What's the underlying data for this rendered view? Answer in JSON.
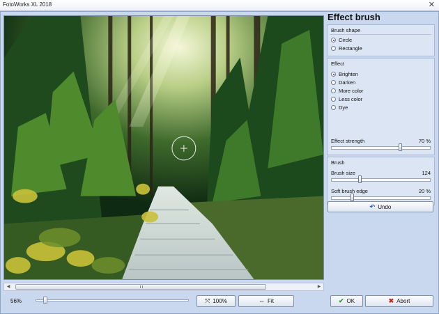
{
  "window": {
    "title": "FotoWorks XL 2018",
    "close_glyph": "✕"
  },
  "panel": {
    "title": "Effect brush",
    "brush_shape": {
      "title": "Brush shape",
      "options": [
        {
          "label": "Circle",
          "selected": true
        },
        {
          "label": "Rectangle",
          "selected": false
        }
      ]
    },
    "effect": {
      "title": "Effect",
      "options": [
        {
          "label": "Brighten",
          "selected": true
        },
        {
          "label": "Darken",
          "selected": false
        },
        {
          "label": "More color",
          "selected": false
        },
        {
          "label": "Less color",
          "selected": false
        },
        {
          "label": "Dye",
          "selected": false
        }
      ]
    },
    "effect_strength": {
      "label": "Effect strength",
      "value_text": "70 %",
      "fraction": 0.7
    },
    "brush": {
      "title": "Brush",
      "size": {
        "label": "Brush size",
        "value_text": "124",
        "fraction": 0.28
      },
      "soft_edge": {
        "label": "Soft brush edge",
        "value_text": "20 %",
        "fraction": 0.2
      }
    },
    "undo_label": "Undo"
  },
  "bottom": {
    "zoom_text": "56%",
    "zoom_fraction": 0.05,
    "btn_100": "100%",
    "btn_fit": "Fit",
    "btn_ok": "OK",
    "btn_abort": "Abort"
  },
  "colors": {
    "ok_icon": "#2e9a2e",
    "abort_icon": "#c0281e",
    "undo_icon": "#2a5fb0"
  }
}
